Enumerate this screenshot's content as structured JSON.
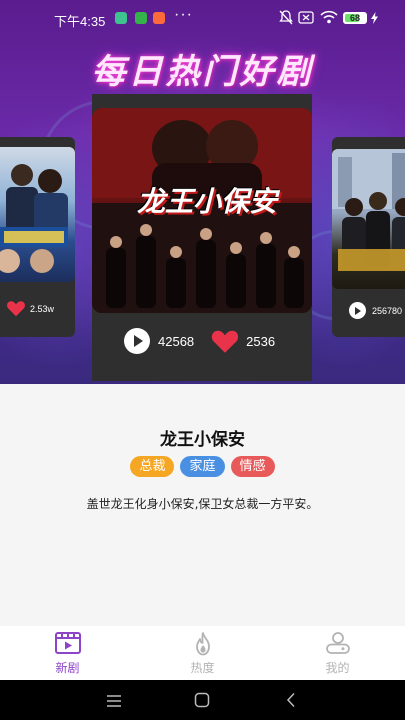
{
  "status_bar": {
    "time": "下午4:35",
    "more": "···",
    "battery_level": "68",
    "battery_fraction": 0.68
  },
  "banner": {
    "title": "每日热门好剧"
  },
  "cards": {
    "left": {
      "likes": "2.53w"
    },
    "center": {
      "plays": "42568",
      "likes": "2536"
    },
    "right": {
      "plays": "256780"
    }
  },
  "poster": {
    "main_title": "龙王小保安"
  },
  "drama": {
    "title": "龙王小保安",
    "tags": [
      {
        "label": "总裁",
        "color": "#f5a623"
      },
      {
        "label": "家庭",
        "color": "#4a90e2"
      },
      {
        "label": "情感",
        "color": "#e85a5a"
      }
    ],
    "description": "盖世龙王化身小保安,保卫女总裁一方平安。"
  },
  "bottom_nav": {
    "items": [
      {
        "label": "新剧",
        "icon": "film-icon",
        "active": true
      },
      {
        "label": "热度",
        "icon": "flame-icon",
        "active": false
      },
      {
        "label": "我的",
        "icon": "user-icon",
        "active": false
      }
    ],
    "active_color": "#8e44c9",
    "inactive_color": "#b3b3b3"
  },
  "colors": {
    "heart": "#e8334a",
    "banner_top": "#5a1c8e",
    "card_bg": "#2f2f2f"
  }
}
